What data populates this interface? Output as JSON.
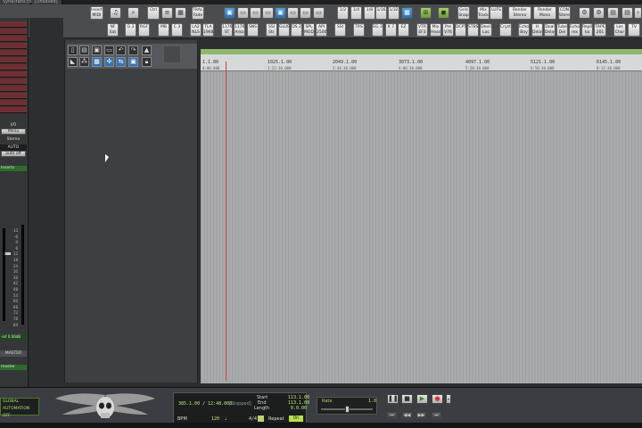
{
  "window": {
    "tabs": [
      "SynaTrans.rpp",
      "[Unsaved]"
    ]
  },
  "toolbar": {
    "row1": [
      {
        "label": "Insert MIDI"
      },
      {
        "label": "Ctrl"
      },
      {
        "label": "TRACK Fade"
      },
      {
        "label": "1/2"
      },
      {
        "label": "1/4"
      },
      {
        "label": "1/8"
      },
      {
        "label": "1/16"
      },
      {
        "label": "1/32"
      },
      {
        "label": "Grid Snap"
      },
      {
        "label": "Mix Track"
      },
      {
        "label": "LUFS"
      },
      {
        "label": "Render Stereo"
      },
      {
        "label": "Render Mono"
      },
      {
        "label": "CON Stereo"
      }
    ],
    "row2": [
      {
        "label": "NF Sat"
      },
      {
        "label": "G 3"
      },
      {
        "label": "RGF"
      },
      {
        "label": "MB"
      },
      {
        "label": "C 3"
      },
      {
        "label": "LA2 NLS"
      },
      {
        "label": "TLA 1968"
      },
      {
        "label": "1176 ST"
      },
      {
        "label": "1176 Arka"
      },
      {
        "label": "SNS"
      },
      {
        "label": "SSI Str"
      },
      {
        "label": "GLUE"
      },
      {
        "label": "DS 2"
      },
      {
        "label": "SPL MOD"
      },
      {
        "label": "API 2500"
      },
      {
        "label": "SSI"
      },
      {
        "label": "TRS"
      },
      {
        "label": "EG 3"
      },
      {
        "label": "K 7"
      },
      {
        "label": "EZ"
      },
      {
        "label": "VTR EF3"
      },
      {
        "label": "Mix Head"
      },
      {
        "label": "Pre V76"
      },
      {
        "label": "DCPT"
      },
      {
        "label": "STBS"
      },
      {
        "label": "Devil Loc"
      },
      {
        "label": "Cryst"
      },
      {
        "label": "Echo Boy"
      },
      {
        "label": "H Delay"
      },
      {
        "label": "Dual Delay"
      },
      {
        "label": "Tube Del"
      },
      {
        "label": "Echo rex"
      },
      {
        "label": "Repli ka"
      },
      {
        "label": "TAPE 201"
      },
      {
        "label": "Les Chor"
      },
      {
        "label": "TV"
      }
    ]
  },
  "leftpanel": {
    "io_label": "I/O",
    "menu_label": "Menu",
    "stereo_label": "Stereo",
    "auto_label": "AUTO",
    "auto_mode": "auto off",
    "inserts_label": "Inserts",
    "db_value": "-inf  0.00dB",
    "master_label": "MASTER",
    "master_name": "master",
    "scale": [
      "-12",
      "-6",
      "0",
      "6",
      "12",
      "18",
      "24",
      "30",
      "36",
      "42",
      "48",
      "54",
      "60",
      "66",
      "72",
      "78",
      "84"
    ]
  },
  "ruler": {
    "ticks": [
      {
        "label": "1.1.00",
        "sub": "0:00.000"
      },
      {
        "label": "1025.1.00",
        "sub": "1:22:30.000"
      },
      {
        "label": "2049.1.00",
        "sub": "2:44:30.000"
      },
      {
        "label": "3073.1.00",
        "sub": "4:06:30.000"
      },
      {
        "label": "4097.1.00",
        "sub": "5:28:30.000"
      },
      {
        "label": "5121.1.00",
        "sub": "6:50:30.000"
      },
      {
        "label": "6145.1.00",
        "sub": "8:12:30.000"
      }
    ]
  },
  "transport": {
    "global_auto": "GLOBAL AUTOMATION",
    "global_auto_state": "OFF",
    "position": "385.1.00 / 12:48.000",
    "state": "[Stopped]",
    "start_label": "Start",
    "end_label": "End",
    "length_label": "Length",
    "start_value": "113.1.00",
    "end_value": "113.1.00",
    "length_value": "0.0.00",
    "bpm_label": "BPM",
    "bpm_value": "120",
    "timesig": "4/4",
    "repeat_label": "Repeat",
    "repeat_state": "On",
    "rate_label": "Rate",
    "rate_value": "1.0"
  }
}
